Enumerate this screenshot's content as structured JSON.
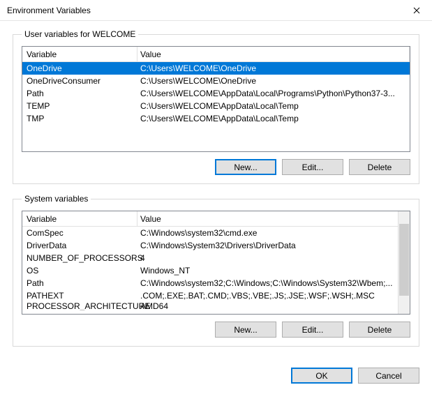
{
  "window": {
    "title": "Environment Variables",
    "close_icon": "close"
  },
  "user_section": {
    "legend": "User variables for WELCOME",
    "headers": {
      "variable": "Variable",
      "value": "Value"
    },
    "rows": [
      {
        "variable": "OneDrive",
        "value": "C:\\Users\\WELCOME\\OneDrive",
        "selected": true
      },
      {
        "variable": "OneDriveConsumer",
        "value": "C:\\Users\\WELCOME\\OneDrive",
        "selected": false
      },
      {
        "variable": "Path",
        "value": "C:\\Users\\WELCOME\\AppData\\Local\\Programs\\Python\\Python37-3...",
        "selected": false
      },
      {
        "variable": "TEMP",
        "value": "C:\\Users\\WELCOME\\AppData\\Local\\Temp",
        "selected": false
      },
      {
        "variable": "TMP",
        "value": "C:\\Users\\WELCOME\\AppData\\Local\\Temp",
        "selected": false
      }
    ],
    "buttons": {
      "new": "New...",
      "edit": "Edit...",
      "delete": "Delete"
    }
  },
  "system_section": {
    "legend": "System variables",
    "headers": {
      "variable": "Variable",
      "value": "Value"
    },
    "rows": [
      {
        "variable": "ComSpec",
        "value": "C:\\Windows\\system32\\cmd.exe"
      },
      {
        "variable": "DriverData",
        "value": "C:\\Windows\\System32\\Drivers\\DriverData"
      },
      {
        "variable": "NUMBER_OF_PROCESSORS",
        "value": "4"
      },
      {
        "variable": "OS",
        "value": "Windows_NT"
      },
      {
        "variable": "Path",
        "value": "C:\\Windows\\system32;C:\\Windows;C:\\Windows\\System32\\Wbem;..."
      },
      {
        "variable": "PATHEXT",
        "value": ".COM;.EXE;.BAT;.CMD;.VBS;.VBE;.JS;.JSE;.WSF;.WSH;.MSC"
      },
      {
        "variable": "PROCESSOR_ARCHITECTURE",
        "value": "AMD64"
      }
    ],
    "buttons": {
      "new": "New...",
      "edit": "Edit...",
      "delete": "Delete"
    }
  },
  "footer": {
    "ok": "OK",
    "cancel": "Cancel"
  }
}
